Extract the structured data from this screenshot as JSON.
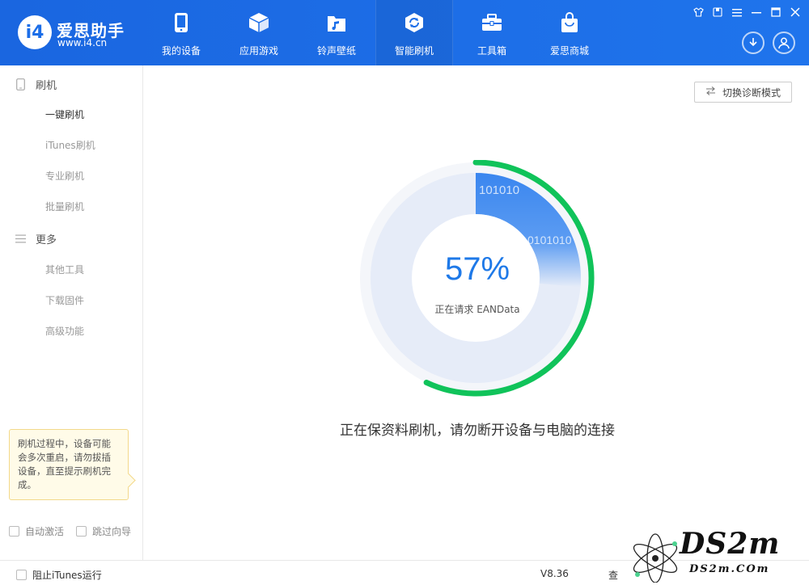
{
  "app": {
    "title": "爱思助手",
    "url": "www.i4.cn",
    "logo_mark": "i4"
  },
  "nav": {
    "items": [
      {
        "label": "我的设备",
        "icon": "phone-icon"
      },
      {
        "label": "应用游戏",
        "icon": "cube-icon"
      },
      {
        "label": "铃声壁纸",
        "icon": "music-folder-icon"
      },
      {
        "label": "智能刷机",
        "icon": "refresh-shield-icon",
        "active": true
      },
      {
        "label": "工具箱",
        "icon": "toolbox-icon"
      },
      {
        "label": "爱思商城",
        "icon": "shopping-bag-icon"
      }
    ]
  },
  "sidebar": {
    "sections": [
      {
        "label": "刷机",
        "icon": "phone-outline-icon"
      },
      {
        "label": "更多",
        "icon": "menu-lines-icon"
      }
    ],
    "flash_items": [
      "一键刷机",
      "iTunes刷机",
      "专业刷机",
      "批量刷机"
    ],
    "more_items": [
      "其他工具",
      "下载固件",
      "高级功能"
    ],
    "current": "一键刷机"
  },
  "tip": {
    "text": "刷机过程中，设备可能会多次重启，请勿拔插设备，直至提示刷机完成。"
  },
  "options": {
    "auto_activate": "自动激活",
    "skip_guide": "跳过向导"
  },
  "main": {
    "diag_button": "切换诊断模式",
    "progress": {
      "percent": 57,
      "percent_text": "57%",
      "sub_text": "正在请求 EANData",
      "binary_1": "101010",
      "binary_2": "0101010"
    },
    "status": "正在保资料刷机，请勿断开设备与电脑的连接"
  },
  "footer": {
    "block_itunes": "阻止iTunes运行",
    "version": "V8.36",
    "extra": "查"
  },
  "watermark": {
    "big": "DS2m",
    "small": "DS2m.COm"
  },
  "colors": {
    "header": "#1c6ee8",
    "accent_blue": "#1e79e8",
    "progress_green": "#10c35a",
    "ring_bg": "#e6ecf8"
  }
}
